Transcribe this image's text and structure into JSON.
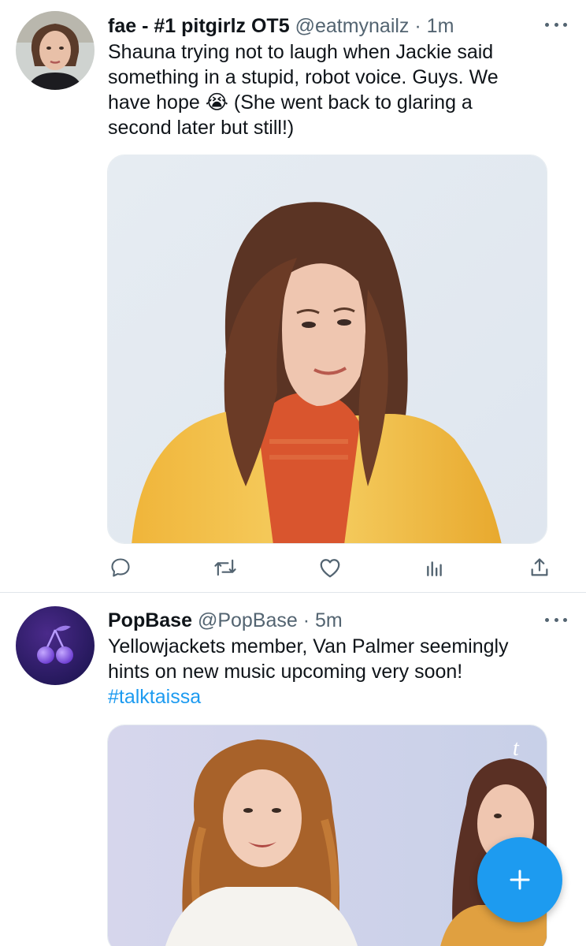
{
  "tweets": [
    {
      "name": "fae - #1 pitgirlz OT5",
      "handle": "@eatmynailz",
      "separator": "·",
      "time": "1m",
      "text_lines": [
        "Shauna trying not to laugh when Jackie said",
        "something in a stupid, robot voice. Guys. We",
        "have hope 😭 (She went back to glaring a",
        "second later but still!)"
      ],
      "media_description_icon": "photo-woman-yellow-blazer",
      "actions": [
        "reply-icon",
        "retweet-icon",
        "like-icon",
        "analytics-icon",
        "share-icon"
      ]
    },
    {
      "name": "PopBase",
      "handle": "@PopBase",
      "separator": "·",
      "time": "5m",
      "text_lines": [
        "Yellowjackets member, Van Palmer seemingly",
        "hints on new music upcoming very soon!"
      ],
      "hashtag": "#talktaissa",
      "media_description_icon": "photo-two-women",
      "watermark": "t"
    }
  ],
  "colors": {
    "accent": "#1d9bf0",
    "text": "#0f1419",
    "secondary": "#536471",
    "divider": "#e1e6ea"
  },
  "fab": {
    "icon": "compose-plus-icon"
  }
}
